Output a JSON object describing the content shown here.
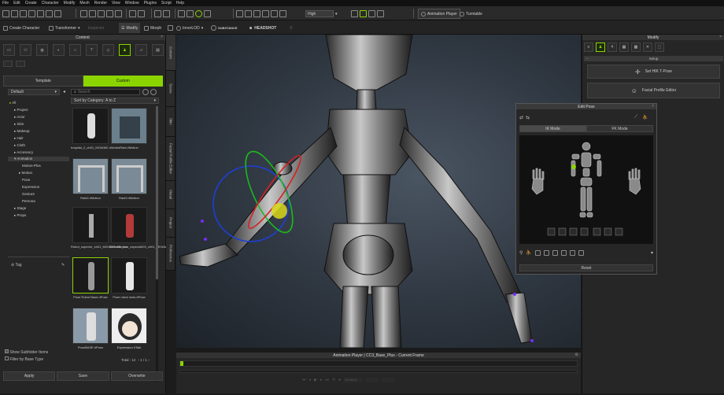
{
  "menubar": {
    "items": [
      "File",
      "Edit",
      "Create",
      "Character",
      "Modify",
      "Mesh",
      "Render",
      "View",
      "Window",
      "Plugins",
      "Script",
      "Help"
    ]
  },
  "toolbar": {
    "render_quality": "High",
    "animation_player": "Animation Player",
    "turntable": "Turntable",
    "create_character": "Create Character",
    "transformer": "Transformer",
    "modify": "Modify",
    "morph": "Morph",
    "inspector": "Inspector",
    "innerlod": "InnerLOD",
    "substance": "SUBSTANCE",
    "headshot": "HEADSHOT"
  },
  "content": {
    "title": "Content",
    "tabs": [
      "Template",
      "Custom"
    ],
    "active_tab": "Custom",
    "filter_value": "Default",
    "search_placeholder": "Search",
    "sort_label": "Sort by Category: A to Z",
    "tree": [
      {
        "label": "All",
        "level": 0
      },
      {
        "label": "Project",
        "level": 1
      },
      {
        "label": "Actor",
        "level": 1
      },
      {
        "label": "Skin",
        "level": 1
      },
      {
        "label": "Makeup",
        "level": 1
      },
      {
        "label": "Hair",
        "level": 1
      },
      {
        "label": "Cloth",
        "level": 1
      },
      {
        "label": "Accessory",
        "level": 1
      },
      {
        "label": "Animation",
        "level": 1
      },
      {
        "label": "Motion-Plus",
        "level": 2
      },
      {
        "label": "Motion",
        "level": 2
      },
      {
        "label": "Pose",
        "level": 2
      },
      {
        "label": "Expression",
        "level": 2
      },
      {
        "label": "Gesture",
        "level": 2
      },
      {
        "label": "Persona",
        "level": 2
      },
      {
        "label": "Stage",
        "level": 1
      },
      {
        "label": "Props",
        "level": 1
      }
    ],
    "tag_label": "Tag",
    "thumbnails": [
      {
        "label": "hospital_2_ch01_MOIAMC.rlMotion"
      },
      {
        "label": "Raid.rlMotion"
      },
      {
        "label": "Raid2.rlMotion"
      },
      {
        "label": "Raid3.rlMotion"
      },
      {
        "label": "Robot_superior_ch01_MIXAMO.rlMotion"
      },
      {
        "label": "Slobodic_con_especia003_ch01_MIXAM..."
      },
      {
        "label": "Pose Robot Base.rlPose"
      },
      {
        "label": "Pose robot mols.rlPose"
      },
      {
        "label": "PoseBASE.rlPose"
      },
      {
        "label": "Expression.rlTalk"
      }
    ],
    "show_subfolder": "Show Subfolder Items",
    "filter_base_type": "Filter by Base Type",
    "total": "Total : 12",
    "page": "1 / 1",
    "buttons": [
      "Apply",
      "Save",
      "Overwrite"
    ]
  },
  "vtabs": [
    "Content",
    "Scene",
    "Skin",
    "Facial Profile Editor",
    "Visual",
    "Project",
    "Preference"
  ],
  "animation_player": {
    "title": "Animation Player | CC3_Base_Plus - Current Frame",
    "fps": "Realtime"
  },
  "modify": {
    "title": "Modify",
    "section": "Setup",
    "tpose": "Set HIK T-Pose",
    "facial_profile": "Facial Profile Editor"
  },
  "edit_pose": {
    "title": "Edit Pose",
    "tabs": [
      "IK Mode",
      "FK Mode"
    ],
    "active_tab": "IK Mode",
    "reset": "Reset"
  },
  "colors": {
    "accent": "#8bd400",
    "panel": "#262626",
    "viewport": "#3a434d"
  }
}
